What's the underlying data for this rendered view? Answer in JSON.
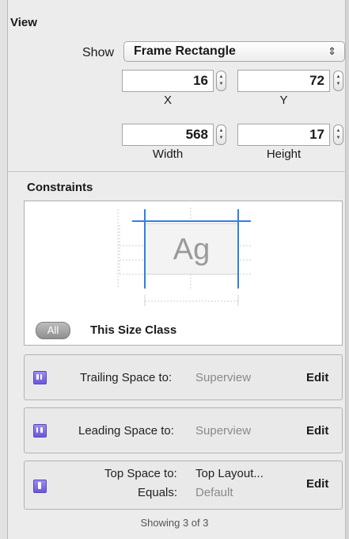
{
  "view": {
    "title": "View",
    "show_label": "Show",
    "show_value": "Frame Rectangle",
    "show_arrows": "⇕",
    "fields": [
      {
        "value": "16",
        "caption": "X"
      },
      {
        "value": "72",
        "caption": "Y"
      },
      {
        "value": "568",
        "caption": "Width"
      },
      {
        "value": "17",
        "caption": "Height"
      }
    ]
  },
  "constraints": {
    "title": "Constraints",
    "preview_text": "Ag",
    "all_label": "All",
    "size_class_label": "This Size Class",
    "rows": [
      {
        "label": "Trailing Space to:",
        "value": "Superview",
        "edit": "Edit",
        "icon": "trailing-space-icon"
      },
      {
        "label": "Leading Space to:",
        "value": "Superview",
        "edit": "Edit",
        "icon": "leading-space-icon"
      },
      {
        "label": "Top Space to:",
        "value": "Top Layout...",
        "label2": "Equals:",
        "value2": "Default",
        "edit": "Edit",
        "icon": "top-space-icon"
      }
    ],
    "showing_text": "Showing 3 of 3"
  },
  "colors": {
    "accent_blue": "#2f7fe6",
    "icon_purple": "#7a67e0"
  }
}
